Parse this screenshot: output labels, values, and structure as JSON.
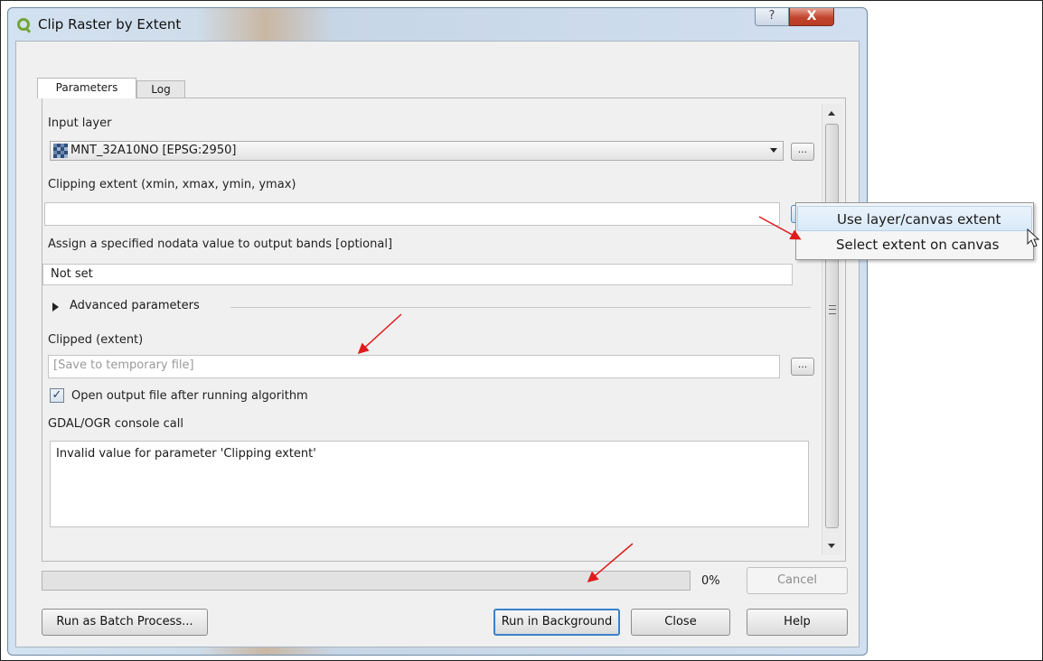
{
  "window": {
    "title": "Clip Raster by Extent",
    "help_glyph": "?",
    "close_glyph": "X"
  },
  "tabs": [
    {
      "label": "Parameters",
      "active": true
    },
    {
      "label": "Log",
      "active": false
    }
  ],
  "params": {
    "input_layer_label": "Input layer",
    "input_layer_value": "MNT_32A10NO [EPSG:2950]",
    "clip_extent_label": "Clipping extent (xmin, xmax, ymin, ymax)",
    "clip_extent_value": "",
    "nodata_label": "Assign a specified nodata value to output bands [optional]",
    "nodata_value": "Not set",
    "advanced_label": "Advanced parameters",
    "output_label": "Clipped (extent)",
    "output_placeholder": "[Save to temporary file]",
    "open_output_label": "Open output file after running algorithm",
    "open_output_checked": true,
    "console_label": "GDAL/OGR console call",
    "console_text": "Invalid value for parameter 'Clipping extent'",
    "browse_glyph": "..."
  },
  "progress": {
    "value_percent": 0,
    "text": "0%"
  },
  "buttons": {
    "cancel": "Cancel",
    "batch": "Run as Batch Process...",
    "background": "Run in Background",
    "close": "Close",
    "help": "Help"
  },
  "context_menu": {
    "items": [
      "Use layer/canvas extent",
      "Select extent on canvas"
    ]
  },
  "colors": {
    "annotation_arrow": "#e01b1b",
    "progress_fill": "#57b55a",
    "qgis_brand": "#73a536"
  },
  "icons": [
    "qgis-logo-icon",
    "help-icon",
    "close-icon",
    "raster-layer-icon",
    "dropdown-arrow-icon",
    "checkmark-icon",
    "expand-triangle-icon",
    "mouse-cursor-icon"
  ]
}
